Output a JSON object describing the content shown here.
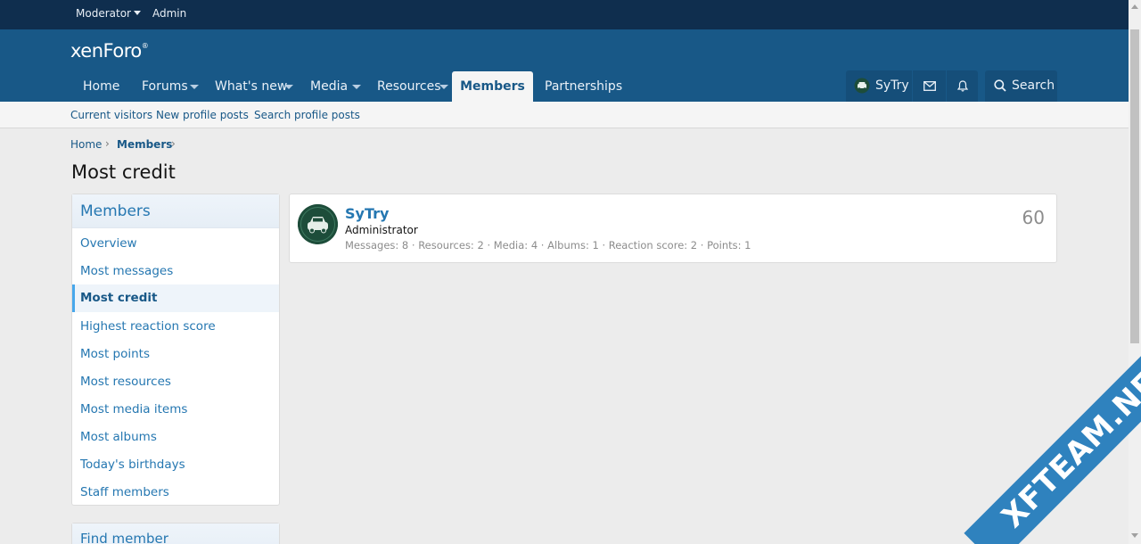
{
  "staff_bar": {
    "moderator": "Moderator",
    "admin": "Admin"
  },
  "header": {
    "logo": "xenForo",
    "logo_mark": "®",
    "tabs": [
      {
        "label": "Home"
      },
      {
        "label": "Forums"
      },
      {
        "label": "What's new"
      },
      {
        "label": "Media"
      },
      {
        "label": "Resources"
      },
      {
        "label": "Members"
      },
      {
        "label": "Partnerships"
      }
    ],
    "user": "SyTry",
    "search": "Search"
  },
  "subnav": {
    "items": [
      "Current visitors",
      "New profile posts",
      "Search profile posts"
    ]
  },
  "breadcrumb": {
    "home": "Home",
    "members": "Members"
  },
  "page_title": "Most credit",
  "sidebar": {
    "title": "Members",
    "items": [
      "Overview",
      "Most messages",
      "Most credit",
      "Highest reaction score",
      "Most points",
      "Most resources",
      "Most media items",
      "Most albums",
      "Today's birthdays",
      "Staff members"
    ],
    "selected": "Most credit",
    "find_title": "Find member"
  },
  "member": {
    "name": "SyTry",
    "title": "Administrator",
    "stats": "Messages: 8 · Resources: 2 · Media: 4 · Albums: 1 · Reaction score: 2 · Points: 1",
    "value": "60"
  },
  "watermark": "XFTEAM.NET",
  "colors": {
    "staff_bar": "#0f2e4e",
    "header": "#185887",
    "link": "#2577b1",
    "page_bg": "#ececec"
  }
}
